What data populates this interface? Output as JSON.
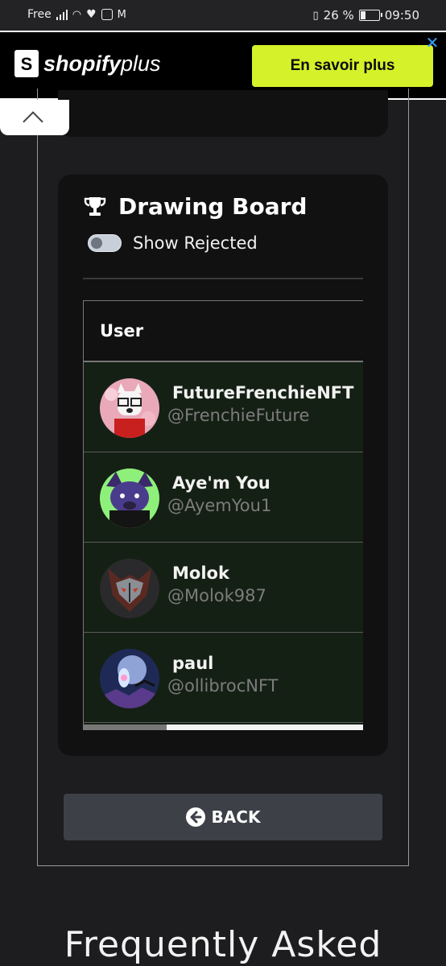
{
  "status_bar": {
    "carrier": "Free",
    "battery": "26 %",
    "time": "09:50"
  },
  "ad": {
    "brand": "shopify",
    "brand_suffix": "plus",
    "cta": "En savoir plus",
    "close": "✕"
  },
  "card": {
    "title": "Drawing Board",
    "toggle_label": "Show Rejected",
    "toggle_on": false,
    "table": {
      "header": "User",
      "rows": [
        {
          "name": "FutureFrenchieNFT",
          "handle": "@FrenchieFuture"
        },
        {
          "name": "Aye'm You",
          "handle": "@AyemYou1"
        },
        {
          "name": "Molok",
          "handle": "@Molok987"
        },
        {
          "name": "paul",
          "handle": "@ollibrocNFT"
        }
      ]
    }
  },
  "back_label": "BACK",
  "faq_heading": "Frequently Asked"
}
